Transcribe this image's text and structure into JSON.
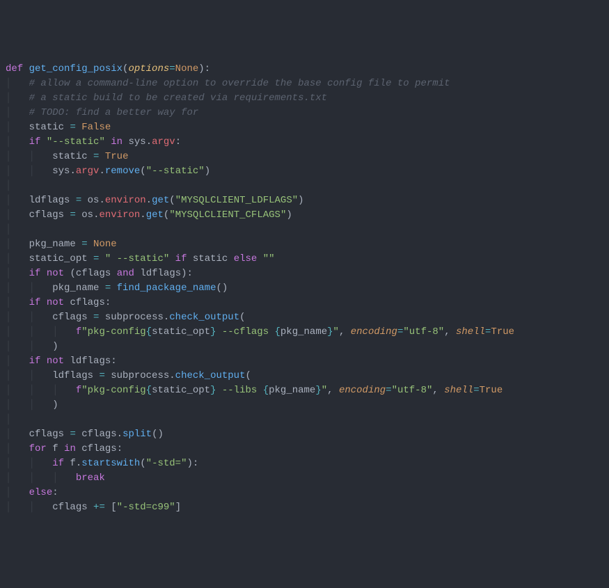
{
  "code": {
    "fn_def_kw": "def",
    "fn_name": "get_config_posix",
    "param_name": "options",
    "param_default": "None",
    "cmt1": "# allow a command-line option to override the base config file to permit",
    "cmt2": "# a static build to be created via requirements.txt",
    "cmt3": "# TODO: find a better way for",
    "static_var": "static",
    "false_kw": "False",
    "true_kw": "True",
    "if_kw": "if",
    "in_kw": "in",
    "not_kw": "not",
    "and_kw": "and",
    "else_kw": "else",
    "for_kw": "for",
    "break_kw": "break",
    "str_static_flag": "\"--static\"",
    "sys_mod": "sys",
    "argv_attr": "argv",
    "remove_fn": "remove",
    "ldflags_var": "ldflags",
    "cflags_var": "cflags",
    "os_mod": "os",
    "environ_attr": "environ",
    "get_fn": "get",
    "str_ldflags_env": "\"MYSQLCLIENT_LDFLAGS\"",
    "str_cflags_env": "\"MYSQLCLIENT_CFLAGS\"",
    "pkg_name_var": "pkg_name",
    "none_kw": "None",
    "static_opt_var": "static_opt",
    "str_static_opt": "\" --static\"",
    "str_empty": "\"\"",
    "find_pkg_fn": "find_package_name",
    "subprocess_mod": "subprocess",
    "check_output_fn": "check_output",
    "f_prefix": "f",
    "fstr_pkg_prefix": "\"pkg-config",
    "fstr_cflags_mid": " --cflags ",
    "fstr_libs_mid": " --libs ",
    "fstr_end_q": "\"",
    "encoding_kw": "encoding",
    "str_utf8": "\"utf-8\"",
    "shell_kw": "shell",
    "split_fn": "split",
    "f_loopvar": "f",
    "startswith_fn": "startswith",
    "str_std": "\"-std=\"",
    "str_stdc99": "\"-std=c99\"",
    "pluseq": "+="
  }
}
